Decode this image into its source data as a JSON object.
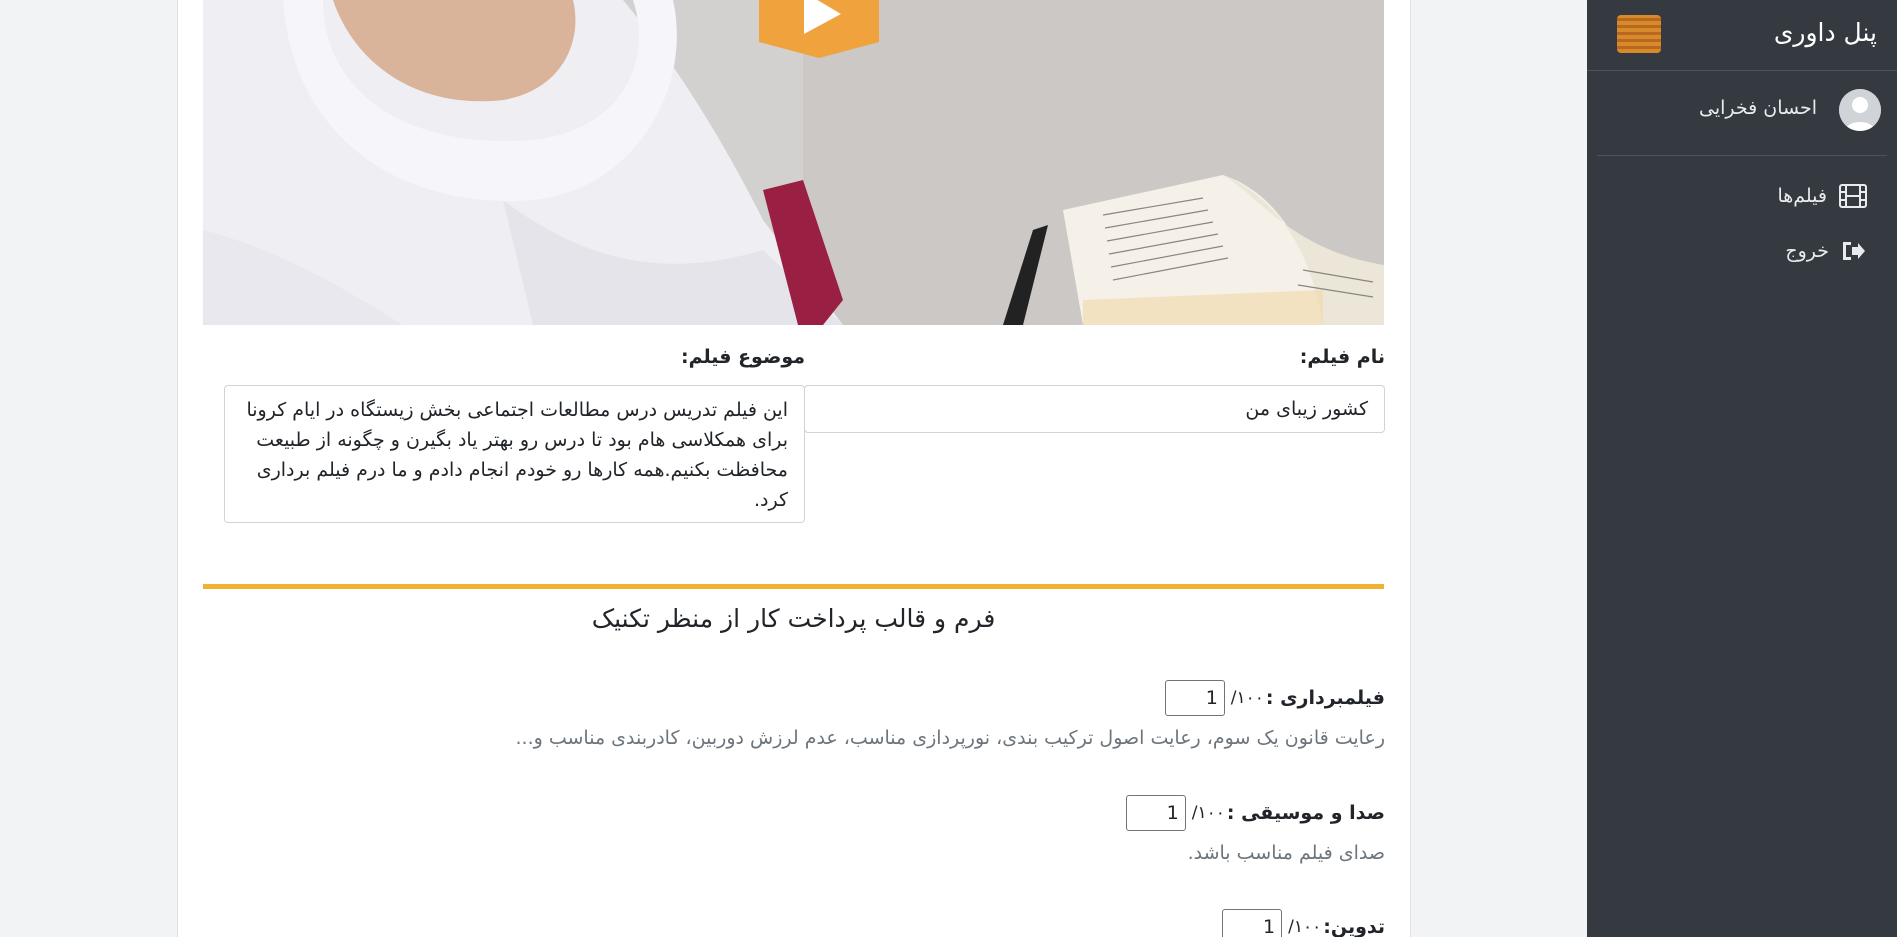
{
  "sidebar": {
    "title": "پنل داوری",
    "user_name": "احسان فخرایی",
    "nav": [
      {
        "label": "فیلم‌ها",
        "icon": "film-icon"
      },
      {
        "label": "خروج",
        "icon": "sign-out-icon"
      }
    ]
  },
  "film": {
    "name_label": "نام فیلم:",
    "name_value": "کشور زیبای من",
    "topic_label": "موضوع فیلم:",
    "topic_value": "این فیلم تدریس درس مطالعات اجتماعی بخش زیستگاه در ایام کرونا برای همکلاسی هام بود تا درس رو بهتر یاد بگیرن و چگونه از طبیعت محافظت بکنیم.همه کارها رو خودم انجام دادم و ما درم فیلم برداری کرد."
  },
  "section": {
    "title": "فرم و قالب پرداخت کار از منظر تکنیک"
  },
  "criteria": [
    {
      "label": "فیلمبرداری :",
      "max": "/۱۰۰",
      "score": "1",
      "description": "رعایت قانون یک سوم، رعایت اصول ترکیب بندی، نورپردازی مناسب، عدم لرزش دوربین، کادربندی مناسب و..."
    },
    {
      "label": "صدا و موسیقی :",
      "max": "/۱۰۰",
      "score": "1",
      "description": "صدای فیلم مناسب باشد."
    },
    {
      "label": "تدوین:",
      "max": "/۱۰۰",
      "score": "1",
      "description": ""
    }
  ],
  "colors": {
    "accent": "#f1b233",
    "play_button": "#f0a23c",
    "sidebar_bg": "#343a40"
  }
}
